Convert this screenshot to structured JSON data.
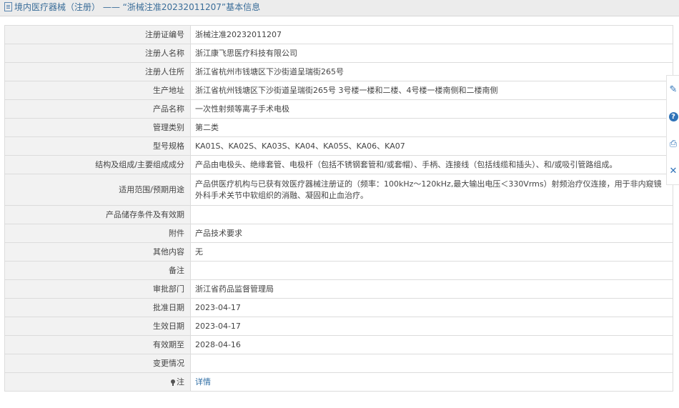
{
  "header": {
    "category": "境内医疗器械（注册）",
    "separator": "——",
    "record_title": "“浙械注准20232011207”基本信息"
  },
  "fields": [
    {
      "label": "注册证编号",
      "value": "浙械注准20232011207"
    },
    {
      "label": "注册人名称",
      "value": "浙江康飞思医疗科技有限公司"
    },
    {
      "label": "注册人住所",
      "value": "浙江省杭州市钱塘区下沙街道呈瑞街265号"
    },
    {
      "label": "生产地址",
      "value": "浙江省杭州钱塘区下沙街道呈瑞街265号 3号楼一楼和二楼、4号楼一楼南侧和二楼南侧"
    },
    {
      "label": "产品名称",
      "value": "一次性射频等离子手术电极"
    },
    {
      "label": "管理类别",
      "value": "第二类"
    },
    {
      "label": "型号规格",
      "value": "KA01S、KA02S、KA03S、KA04、KA05S、KA06、KA07"
    },
    {
      "label": "结构及组成/主要组成成分",
      "value": "产品由电极头、绝缘套管、电极杆（包括不锈钢套管和/或套帽）、手柄、连接线（包括线缆和插头）、和/或吸引管路组成。"
    },
    {
      "label": "适用范围/预期用途",
      "value": "产品供医疗机构与已获有效医疗器械注册证的（频率：100kHz～120kHz,最大输出电压＜330Vrms）射频治疗仪连接，用于非内窥镜外科手术关节中软组织的消融、凝固和止血治疗。"
    },
    {
      "label": "产品储存条件及有效期",
      "value": ""
    },
    {
      "label": "附件",
      "value": "产品技术要求"
    },
    {
      "label": "其他内容",
      "value": "无"
    },
    {
      "label": "备注",
      "value": ""
    },
    {
      "label": "审批部门",
      "value": "浙江省药品监督管理局"
    },
    {
      "label": "批准日期",
      "value": "2023-04-17"
    },
    {
      "label": "生效日期",
      "value": "2023-04-17"
    },
    {
      "label": "有效期至",
      "value": "2028-04-16"
    },
    {
      "label": "变更情况",
      "value": ""
    }
  ],
  "note_row": {
    "label": "注",
    "link": "详情"
  },
  "side_tools": [
    {
      "name": "edit-icon",
      "glyph": "✎"
    },
    {
      "name": "help-icon",
      "glyph": "?"
    },
    {
      "name": "print-icon",
      "glyph": "⎙"
    },
    {
      "name": "close-icon",
      "glyph": "✕"
    }
  ],
  "colors": {
    "link": "#2e6da4",
    "label_bg": "#f2f2f2",
    "title_bg": "#ececec",
    "accent": "#2f73b8"
  }
}
